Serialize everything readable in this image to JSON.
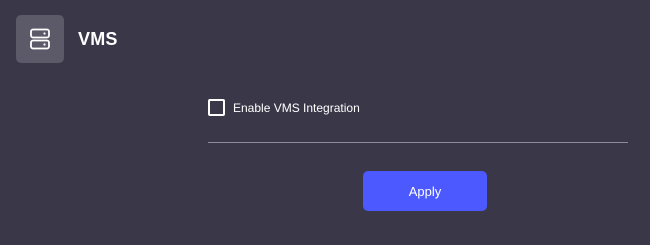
{
  "header": {
    "icon": "server-icon",
    "title": "VMS"
  },
  "options": {
    "enable_vms": {
      "label": "Enable VMS Integration",
      "checked": false
    }
  },
  "actions": {
    "apply_label": "Apply"
  },
  "colors": {
    "background": "#3a3749",
    "icon_box": "#5c5a68",
    "divider": "#8e8c99",
    "accent": "#4b59ff",
    "text": "#ffffff"
  }
}
